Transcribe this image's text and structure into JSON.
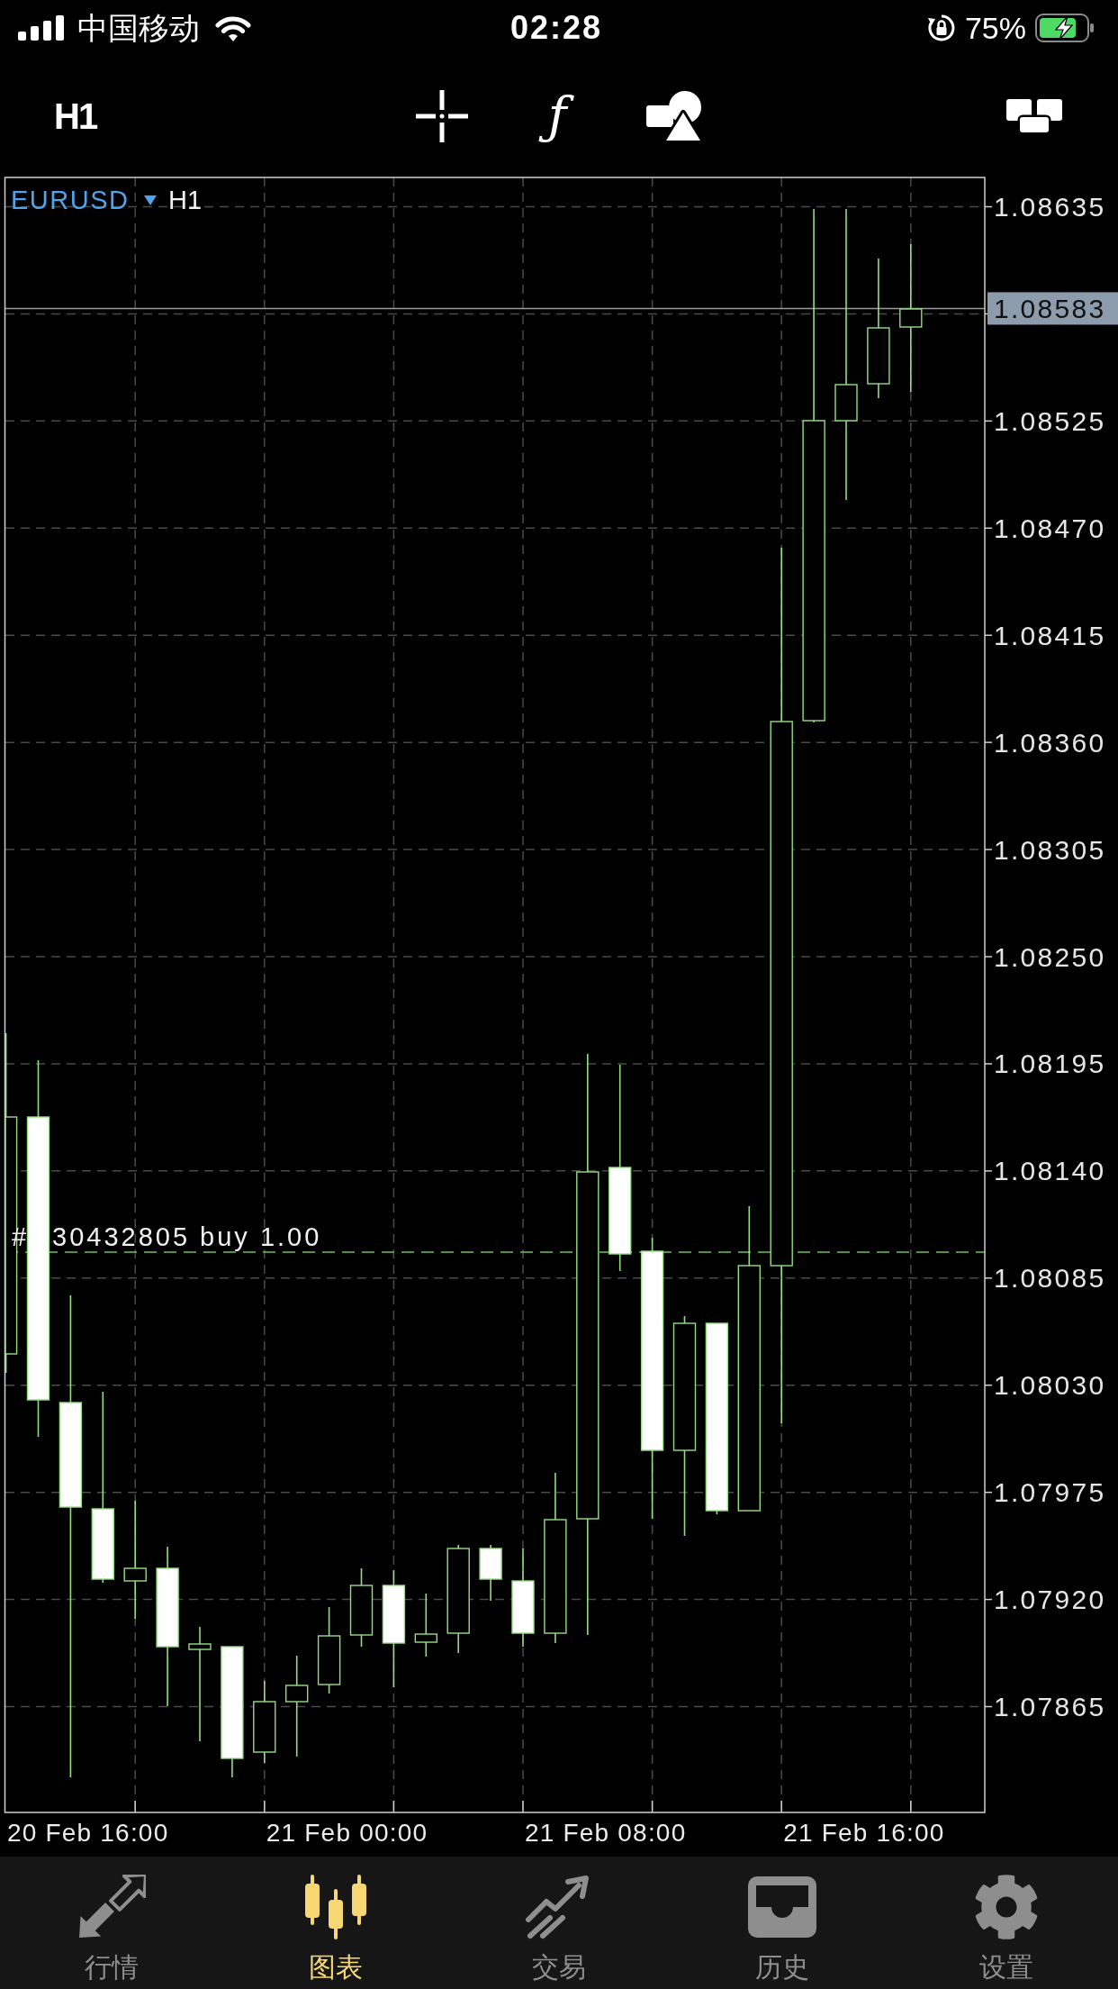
{
  "status_bar": {
    "carrier": "中国移动",
    "time": "02:28",
    "battery": "75%"
  },
  "toolbar": {
    "timeframe": "H1",
    "indicators": "ƒ"
  },
  "chart": {
    "symbol": "EURUSD",
    "timeframe": "H1",
    "price_axis": [
      {
        "kind": "tick",
        "label": "1.08635"
      },
      {
        "kind": "current",
        "label": "1.08583"
      },
      {
        "kind": "tick",
        "label": "1.08525"
      },
      {
        "kind": "tick",
        "label": "1.08470"
      },
      {
        "kind": "tick",
        "label": "1.08415"
      },
      {
        "kind": "tick",
        "label": "1.08360"
      },
      {
        "kind": "tick",
        "label": "1.08305"
      },
      {
        "kind": "tick",
        "label": "1.08250"
      },
      {
        "kind": "tick",
        "label": "1.08195"
      },
      {
        "kind": "tick",
        "label": "1.08140"
      },
      {
        "kind": "tick",
        "label": "1.08085"
      },
      {
        "kind": "tick",
        "label": "1.08030"
      },
      {
        "kind": "tick",
        "label": "1.07975"
      },
      {
        "kind": "tick",
        "label": "1.07920"
      },
      {
        "kind": "tick",
        "label": "1.07865"
      }
    ],
    "time_axis": [
      "20 Feb 16:00",
      "21 Feb 00:00",
      "21 Feb 08:00",
      "21 Feb 16:00"
    ],
    "order_line": {
      "prefix": "#",
      "text": "30432805 buy 1.00"
    }
  },
  "tab_bar": {
    "tabs": [
      {
        "label": "行情",
        "selected": false
      },
      {
        "label": "图表",
        "selected": true
      },
      {
        "label": "交易",
        "selected": false
      },
      {
        "label": "历史",
        "selected": false
      },
      {
        "label": "设置",
        "selected": false
      }
    ]
  }
}
